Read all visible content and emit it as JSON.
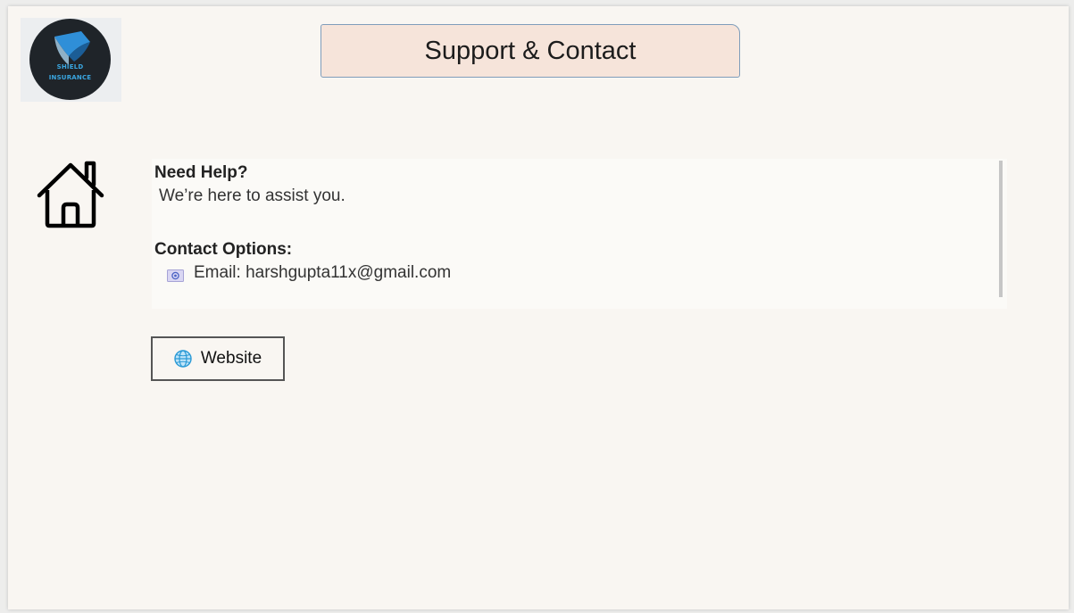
{
  "logo": {
    "line1": "SHIELD",
    "line2": "INSURANCE",
    "text_color": "#3aa6e0",
    "bg_color": "#1f2429"
  },
  "header": {
    "title": "Support & Contact",
    "title_bg": "#f6e4da"
  },
  "nav": {
    "home_icon": "home-icon"
  },
  "help": {
    "heading": "Need Help?",
    "subtext": " We’re here to assist you.",
    "contact_heading": "Contact Options:",
    "email_label": "Email: harshgupta11x@gmail.com",
    "email_icon": "envelope-icon"
  },
  "actions": {
    "website_label": "Website",
    "website_icon": "globe-icon"
  }
}
